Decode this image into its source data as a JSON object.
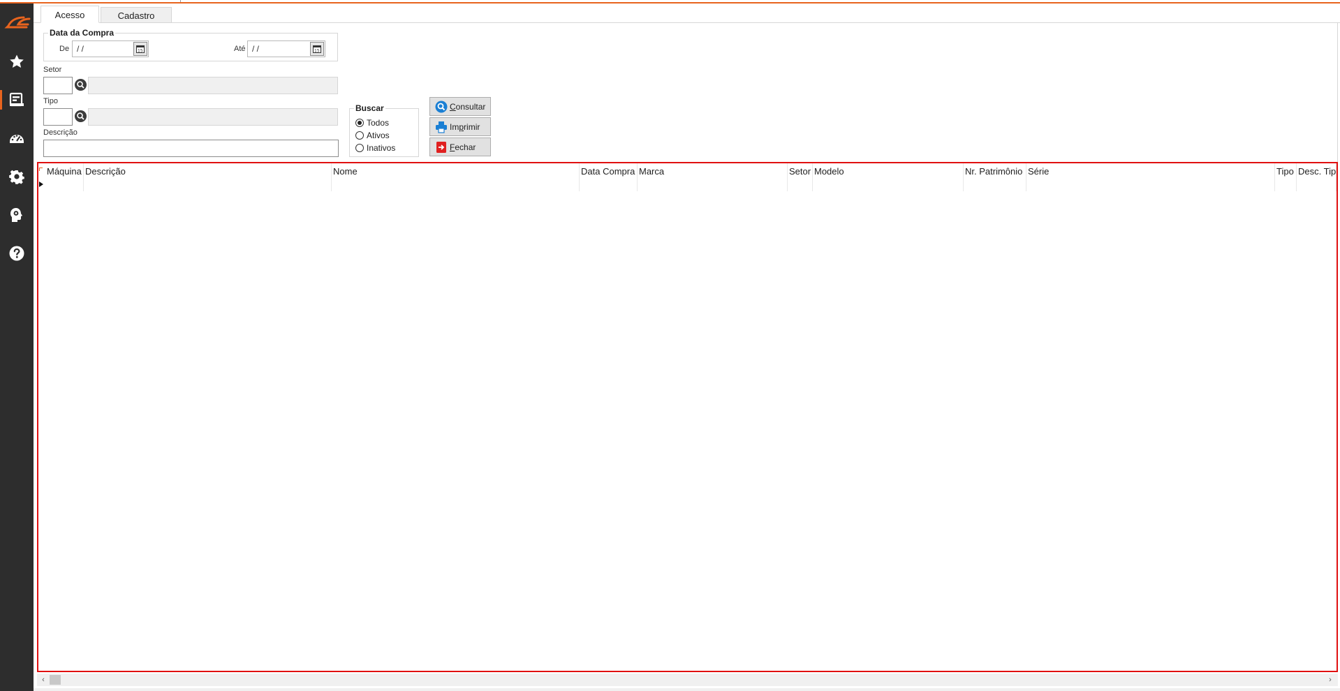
{
  "colors": {
    "accent": "#e8641e",
    "sidebar": "#2d2d2d",
    "grid_border": "#e01010"
  },
  "sidebar": {
    "logo": "ce-logo",
    "items": [
      {
        "icon": "star-icon"
      },
      {
        "icon": "document-icon",
        "active": true
      },
      {
        "icon": "dashboard-gauge-icon"
      },
      {
        "icon": "gear-icon"
      },
      {
        "icon": "head-gear-icon"
      },
      {
        "icon": "help-icon"
      }
    ]
  },
  "tabs": [
    {
      "label": "Acesso",
      "active": true
    },
    {
      "label": "Cadastro",
      "active": false
    }
  ],
  "filters": {
    "data_compra": {
      "title": "Data da Compra",
      "de_label": "De",
      "de_value": " /  /",
      "ate_label": "Até",
      "ate_value": " /  /"
    },
    "setor_label": "Setor",
    "setor_code": "",
    "setor_desc": "",
    "tipo_label": "Tipo",
    "tipo_code": "",
    "tipo_desc": "",
    "descricao_label": "Descrição",
    "descricao_value": ""
  },
  "buscar": {
    "title": "Buscar",
    "options": [
      "Todos",
      "Ativos",
      "Inativos"
    ],
    "selected": "Todos"
  },
  "actions": {
    "consultar_first": "C",
    "consultar_rest": "onsultar",
    "imprimir_first": "Im",
    "imprimir_u": "p",
    "imprimir_rest": "rimir",
    "fechar_first": "F",
    "fechar_rest": "echar"
  },
  "grid": {
    "columns": [
      "Máquina",
      "Descrição",
      "Nome",
      "Data Compra",
      "Marca",
      "Setor",
      "Modelo",
      "Nr. Patrimônio",
      "Série",
      "Tipo",
      "Desc. Tipo"
    ],
    "rows": []
  }
}
